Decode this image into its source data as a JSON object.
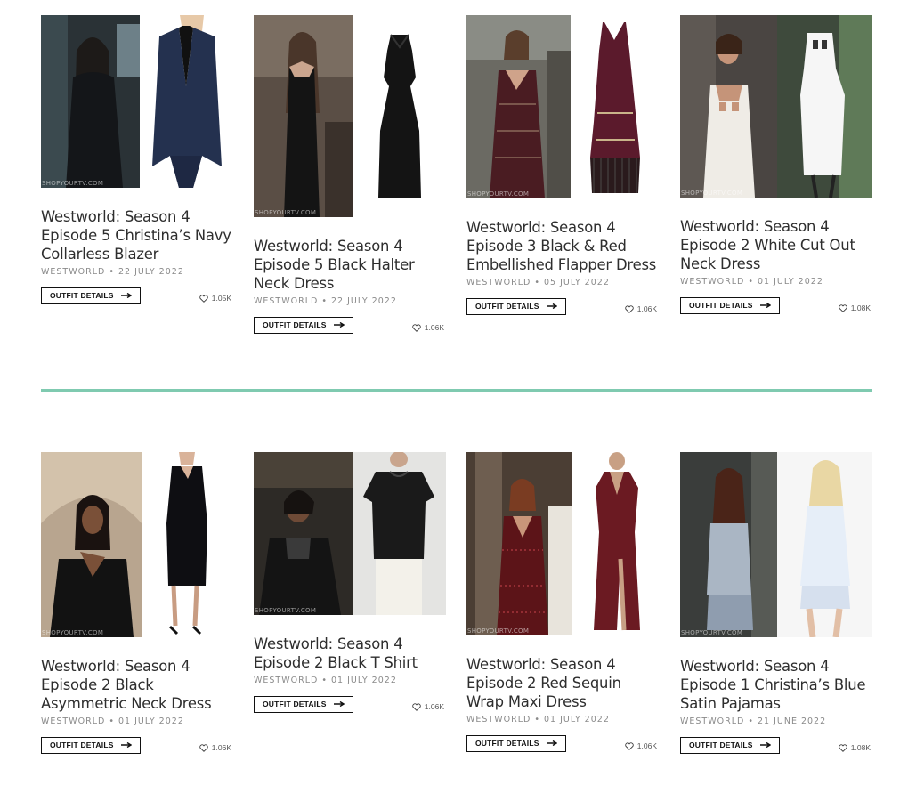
{
  "watermark": "SHOPYOURTV.COM",
  "colors": {
    "divider": "#7fcab0",
    "text": "#2e2e2e",
    "meta": "#8a8a8a"
  },
  "icons": {
    "like": "heart-outline-icon",
    "arrow": "arrow-right-icon"
  },
  "button_label": "OUTFIT DETAILS",
  "rows": [
    {
      "cards": [
        {
          "title": "Westworld: Season 4 Episode 5 Christina’s Navy Collarless Blazer",
          "category": "WESTWORLD",
          "date": "22 JULY 2022",
          "likes": "1.05K"
        },
        {
          "title": "Westworld: Season 4 Episode 5 Black Halter Neck Dress",
          "category": "WESTWORLD",
          "date": "22 JULY 2022",
          "likes": "1.06K"
        },
        {
          "title": "Westworld: Season 4 Episode 3 Black & Red Embellished Flapper Dress",
          "category": "WESTWORLD",
          "date": "05 JULY 2022",
          "likes": "1.06K"
        },
        {
          "title": "Westworld: Season 4 Episode 2 White Cut Out Neck Dress",
          "category": "WESTWORLD",
          "date": "01 JULY 2022",
          "likes": "1.08K"
        }
      ]
    },
    {
      "cards": [
        {
          "title": "Westworld: Season 4 Episode 2 Black Asymmetric Neck Dress",
          "category": "WESTWORLD",
          "date": "01 JULY 2022",
          "likes": "1.06K"
        },
        {
          "title": "Westworld: Season 4 Episode 2 Black T Shirt",
          "category": "WESTWORLD",
          "date": "01 JULY 2022",
          "likes": "1.06K"
        },
        {
          "title": "Westworld: Season 4 Episode 2 Red Sequin Wrap Maxi Dress",
          "category": "WESTWORLD",
          "date": "01 JULY 2022",
          "likes": "1.06K"
        },
        {
          "title": "Westworld: Season 4 Episode 1 Christina’s Blue Satin Pajamas",
          "category": "WESTWORLD",
          "date": "21 JUNE 2022",
          "likes": "1.08K"
        }
      ]
    }
  ]
}
